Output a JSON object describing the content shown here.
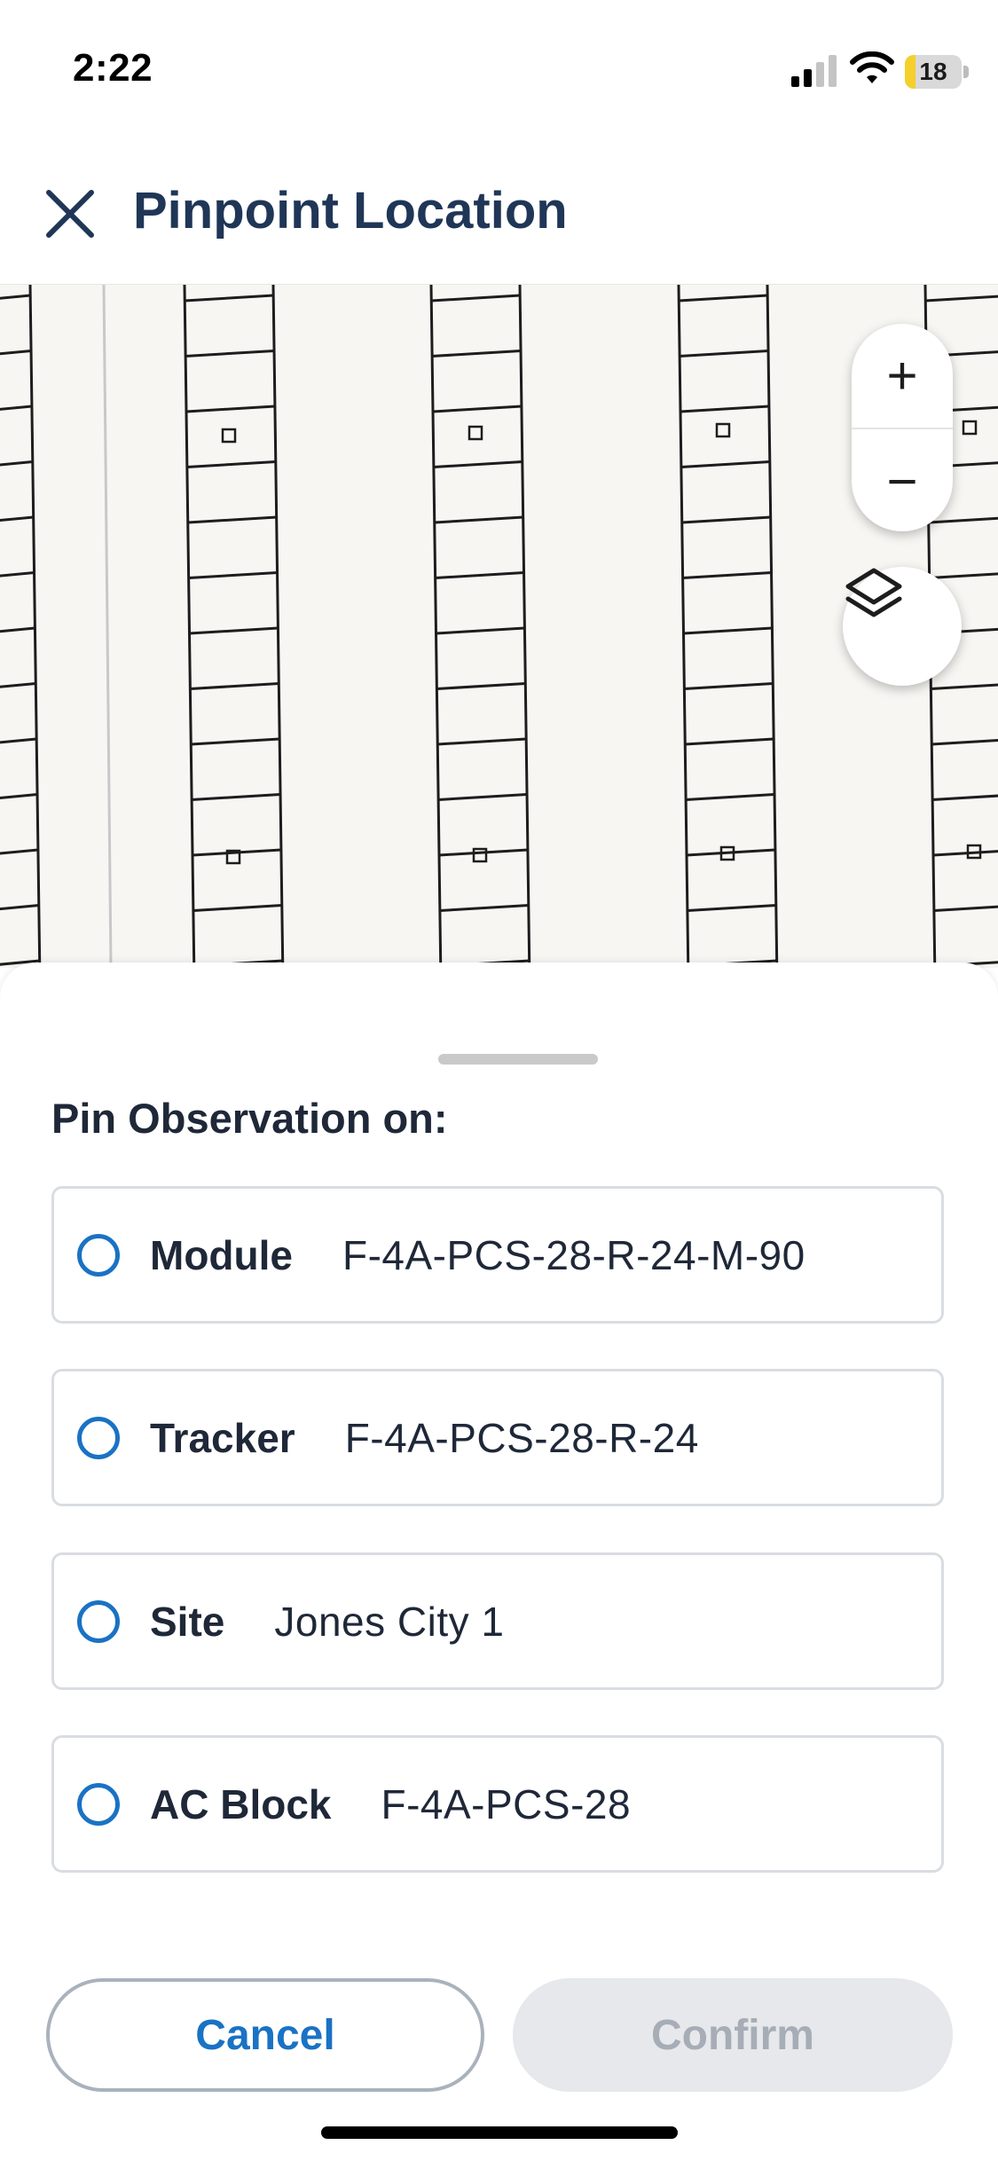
{
  "status_bar": {
    "time": "2:22",
    "battery": "18",
    "battery_level": 0.18,
    "battery_color": "#f5cf2b",
    "signal_bars": 2,
    "icons": [
      "cellular-signal-icon",
      "wifi-icon",
      "battery-icon"
    ]
  },
  "header": {
    "title": "Pinpoint Location",
    "close_icon": "close-icon",
    "title_color": "#1f3657"
  },
  "map": {
    "controls": {
      "zoom_in": "+",
      "zoom_out": "−",
      "layers_icon": "layers-icon"
    },
    "background_color": "#f7f6f3"
  },
  "sheet": {
    "title": "Pin Observation on:",
    "options": [
      {
        "label": "Module",
        "value": "F-4A-PCS-28-R-24-M-90",
        "selected": false
      },
      {
        "label": "Tracker",
        "value": "F-4A-PCS-28-R-24",
        "selected": false
      },
      {
        "label": "Site",
        "value": "Jones City 1",
        "selected": false
      },
      {
        "label": "AC Block",
        "value": "F-4A-PCS-28",
        "selected": false
      }
    ],
    "cancel_label": "Cancel",
    "confirm_label": "Confirm",
    "confirm_enabled": false,
    "accent_color": "#1a72c4"
  }
}
